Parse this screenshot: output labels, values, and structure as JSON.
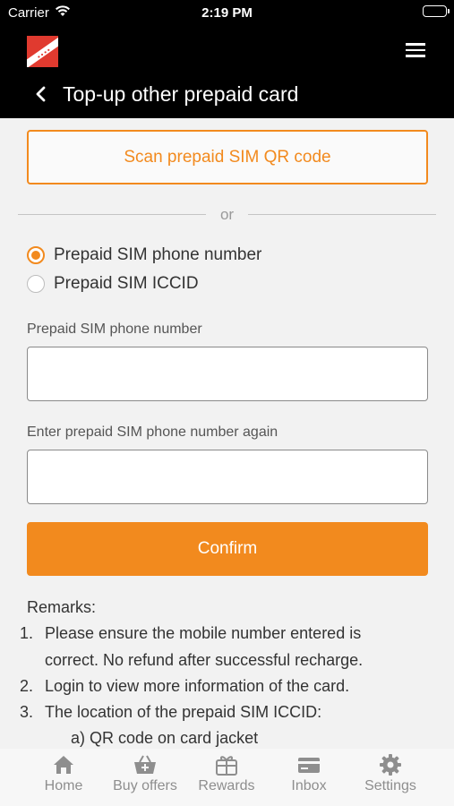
{
  "status_bar": {
    "carrier": "Carrier",
    "time": "2:19 PM",
    "wifi_icon": "wifi-icon",
    "battery_icon": "battery-icon"
  },
  "header": {
    "logo_icon": "brand-logo-icon",
    "menu_icon": "hamburger-menu-icon",
    "back_icon": "chevron-left-icon",
    "title": "Top-up other prepaid card"
  },
  "scan_button_label": "Scan prepaid SIM QR code",
  "divider_text": "or",
  "options": [
    {
      "label": "Prepaid SIM phone number",
      "selected": true
    },
    {
      "label": "Prepaid SIM ICCID",
      "selected": false
    }
  ],
  "fields": {
    "phone_label": "Prepaid SIM phone number",
    "phone_value": "",
    "phone_again_label": "Enter prepaid SIM phone number again",
    "phone_again_value": ""
  },
  "confirm_label": "Confirm",
  "remarks": {
    "title": "Remarks:",
    "items": [
      {
        "num": "1.",
        "line1": "Please ensure the mobile number entered is",
        "line2": "correct. No refund after successful recharge."
      },
      {
        "num": "2.",
        "line1": "Login to view more information of the card."
      },
      {
        "num": "3.",
        "line1": "The location of the prepaid SIM ICCID:"
      }
    ],
    "sub_item": "a) QR code on card jacket"
  },
  "tabs": [
    {
      "label": "Home",
      "icon": "home-icon"
    },
    {
      "label": "Buy offers",
      "icon": "basket-icon"
    },
    {
      "label": "Rewards",
      "icon": "gift-icon"
    },
    {
      "label": "Inbox",
      "icon": "card-icon"
    },
    {
      "label": "Settings",
      "icon": "gear-icon"
    }
  ],
  "colors": {
    "accent": "#f28a1e",
    "header_bg": "#000000",
    "page_bg": "#f2f2f2",
    "tab_icon": "#8e8e8e"
  }
}
